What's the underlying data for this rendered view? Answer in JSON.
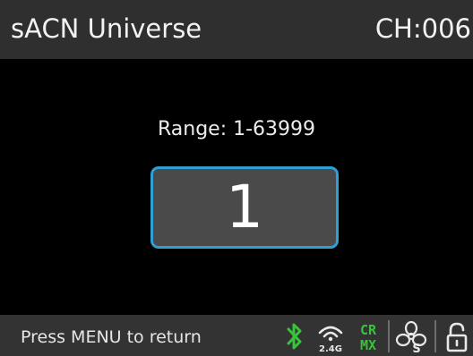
{
  "header": {
    "title": "sACN Universe",
    "channel": "CH:006"
  },
  "main": {
    "range_label": "Range: 1-63999",
    "value": "1"
  },
  "footer": {
    "hint": "Press MENU to return",
    "wireless_band": "2.4G",
    "crmx_top": "CR",
    "crmx_bottom": "MX",
    "fan_mode": "S"
  },
  "icons": {
    "bluetooth": "bluetooth-icon",
    "wireless": "wireless-2-4g-icon",
    "crmx": "crmx-icon",
    "fan": "fan-icon",
    "lock": "unlock-icon"
  },
  "colors": {
    "accent_border": "#2f9fd8",
    "status_green": "#39c23c",
    "header_bg": "#2f2f2f",
    "footer_bg": "#333333",
    "value_box_bg": "#4a4a4a"
  }
}
